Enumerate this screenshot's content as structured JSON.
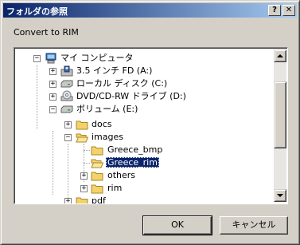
{
  "window": {
    "title": "フォルダの参照",
    "help_button": "?",
    "close_button": "✕"
  },
  "description": "Convert to RIM",
  "tree": {
    "items": [
      {
        "label": "マイ コンピュータ",
        "icon": "computer-icon",
        "expander": "−"
      },
      {
        "label": "3.5 インチ FD (A:)",
        "icon": "floppy-drive-icon",
        "expander": "+"
      },
      {
        "label": "ローカル ディスク (C:)",
        "icon": "hard-drive-icon",
        "expander": "+"
      },
      {
        "label": "DVD/CD-RW ドライブ (D:)",
        "icon": "dvd-drive-icon",
        "expander": "+"
      },
      {
        "label": "ボリューム (E:)",
        "icon": "hard-drive-icon",
        "expander": "−"
      },
      {
        "label": "docs",
        "icon": "folder-icon",
        "expander": "+"
      },
      {
        "label": "images",
        "icon": "open-folder-icon",
        "expander": "−"
      },
      {
        "label": "Greece_bmp",
        "icon": "folder-icon",
        "expander": ""
      },
      {
        "label": "Greece_rim",
        "icon": "open-folder-icon",
        "expander": "",
        "selected": true
      },
      {
        "label": "others",
        "icon": "folder-icon",
        "expander": "+"
      },
      {
        "label": "rim",
        "icon": "folder-icon",
        "expander": "+"
      },
      {
        "label": "pdf",
        "icon": "folder-icon",
        "expander": "+"
      }
    ]
  },
  "buttons": {
    "ok": "OK",
    "cancel": "キャンセル"
  },
  "colors": {
    "title_gradient_start": "#0a246a",
    "title_gradient_end": "#a6caf0",
    "selection": "#0a246a",
    "dialog_face": "#d4d0c8"
  }
}
